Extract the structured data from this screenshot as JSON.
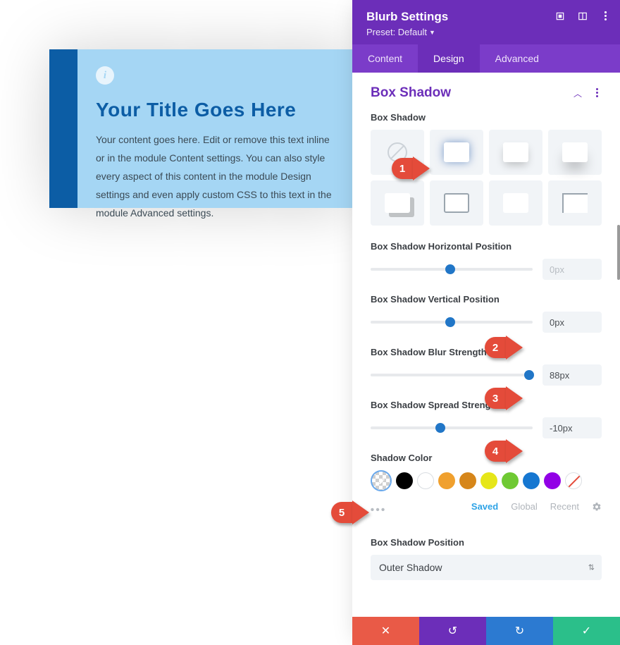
{
  "preview": {
    "title": "Your Title Goes Here",
    "body": "Your content goes here. Edit or remove this text inline or in the module Content settings. You can also style every aspect of this content in the module Design settings and even apply custom CSS to this text in the module Advanced settings."
  },
  "panel": {
    "title": "Blurb Settings",
    "preset_label": "Preset: Default",
    "tabs": {
      "content": "Content",
      "design": "Design",
      "advanced": "Advanced"
    }
  },
  "section": {
    "title": "Box Shadow",
    "shadow_label": "Box Shadow",
    "horiz_label": "Box Shadow Horizontal Position",
    "horiz_value": "",
    "horiz_placeholder": "0px",
    "vert_label": "Box Shadow Vertical Position",
    "vert_value": "0px",
    "blur_label": "Box Shadow Blur Strength",
    "blur_value": "88px",
    "spread_label": "Box Shadow Spread Strength",
    "spread_value": "-10px",
    "color_label": "Shadow Color",
    "color_tabs": {
      "saved": "Saved",
      "global": "Global",
      "recent": "Recent"
    },
    "position_label": "Box Shadow Position",
    "position_value": "Outer Shadow"
  },
  "swatches": [
    "transparent",
    "#000000",
    "#ffffff",
    "#f0a02e",
    "#d6861a",
    "#e6e619",
    "#6fc933",
    "#1677d1",
    "#9200e6",
    "none"
  ],
  "callouts": {
    "c1": "1",
    "c2": "2",
    "c3": "3",
    "c4": "4",
    "c5": "5"
  },
  "footer_icons": {
    "close": "✕",
    "undo": "↺",
    "redo": "↻",
    "confirm": "✓"
  }
}
